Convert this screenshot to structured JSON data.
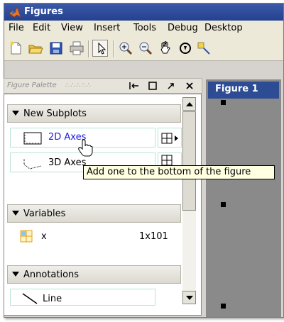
{
  "window": {
    "title": "Figures"
  },
  "menu": [
    "File",
    "Edit",
    "View",
    "Insert",
    "Tools",
    "Debug",
    "Desktop"
  ],
  "palette": {
    "title": "Figure Palette",
    "sections": {
      "subplots": "New Subplots",
      "variables": "Variables",
      "annotations": "Annotations"
    },
    "items": {
      "axes2d": "2D Axes",
      "axes3d": "3D Axes",
      "variable_name": "x",
      "variable_size": "1x101",
      "line": "Line"
    }
  },
  "figure": {
    "tab_label": "Figure 1"
  },
  "tooltip": "Add one to the bottom of the figure",
  "colors": {
    "title_bar": "#25418f",
    "figure_tab": "#2d4c93",
    "link_text": "#1a1ae6"
  }
}
